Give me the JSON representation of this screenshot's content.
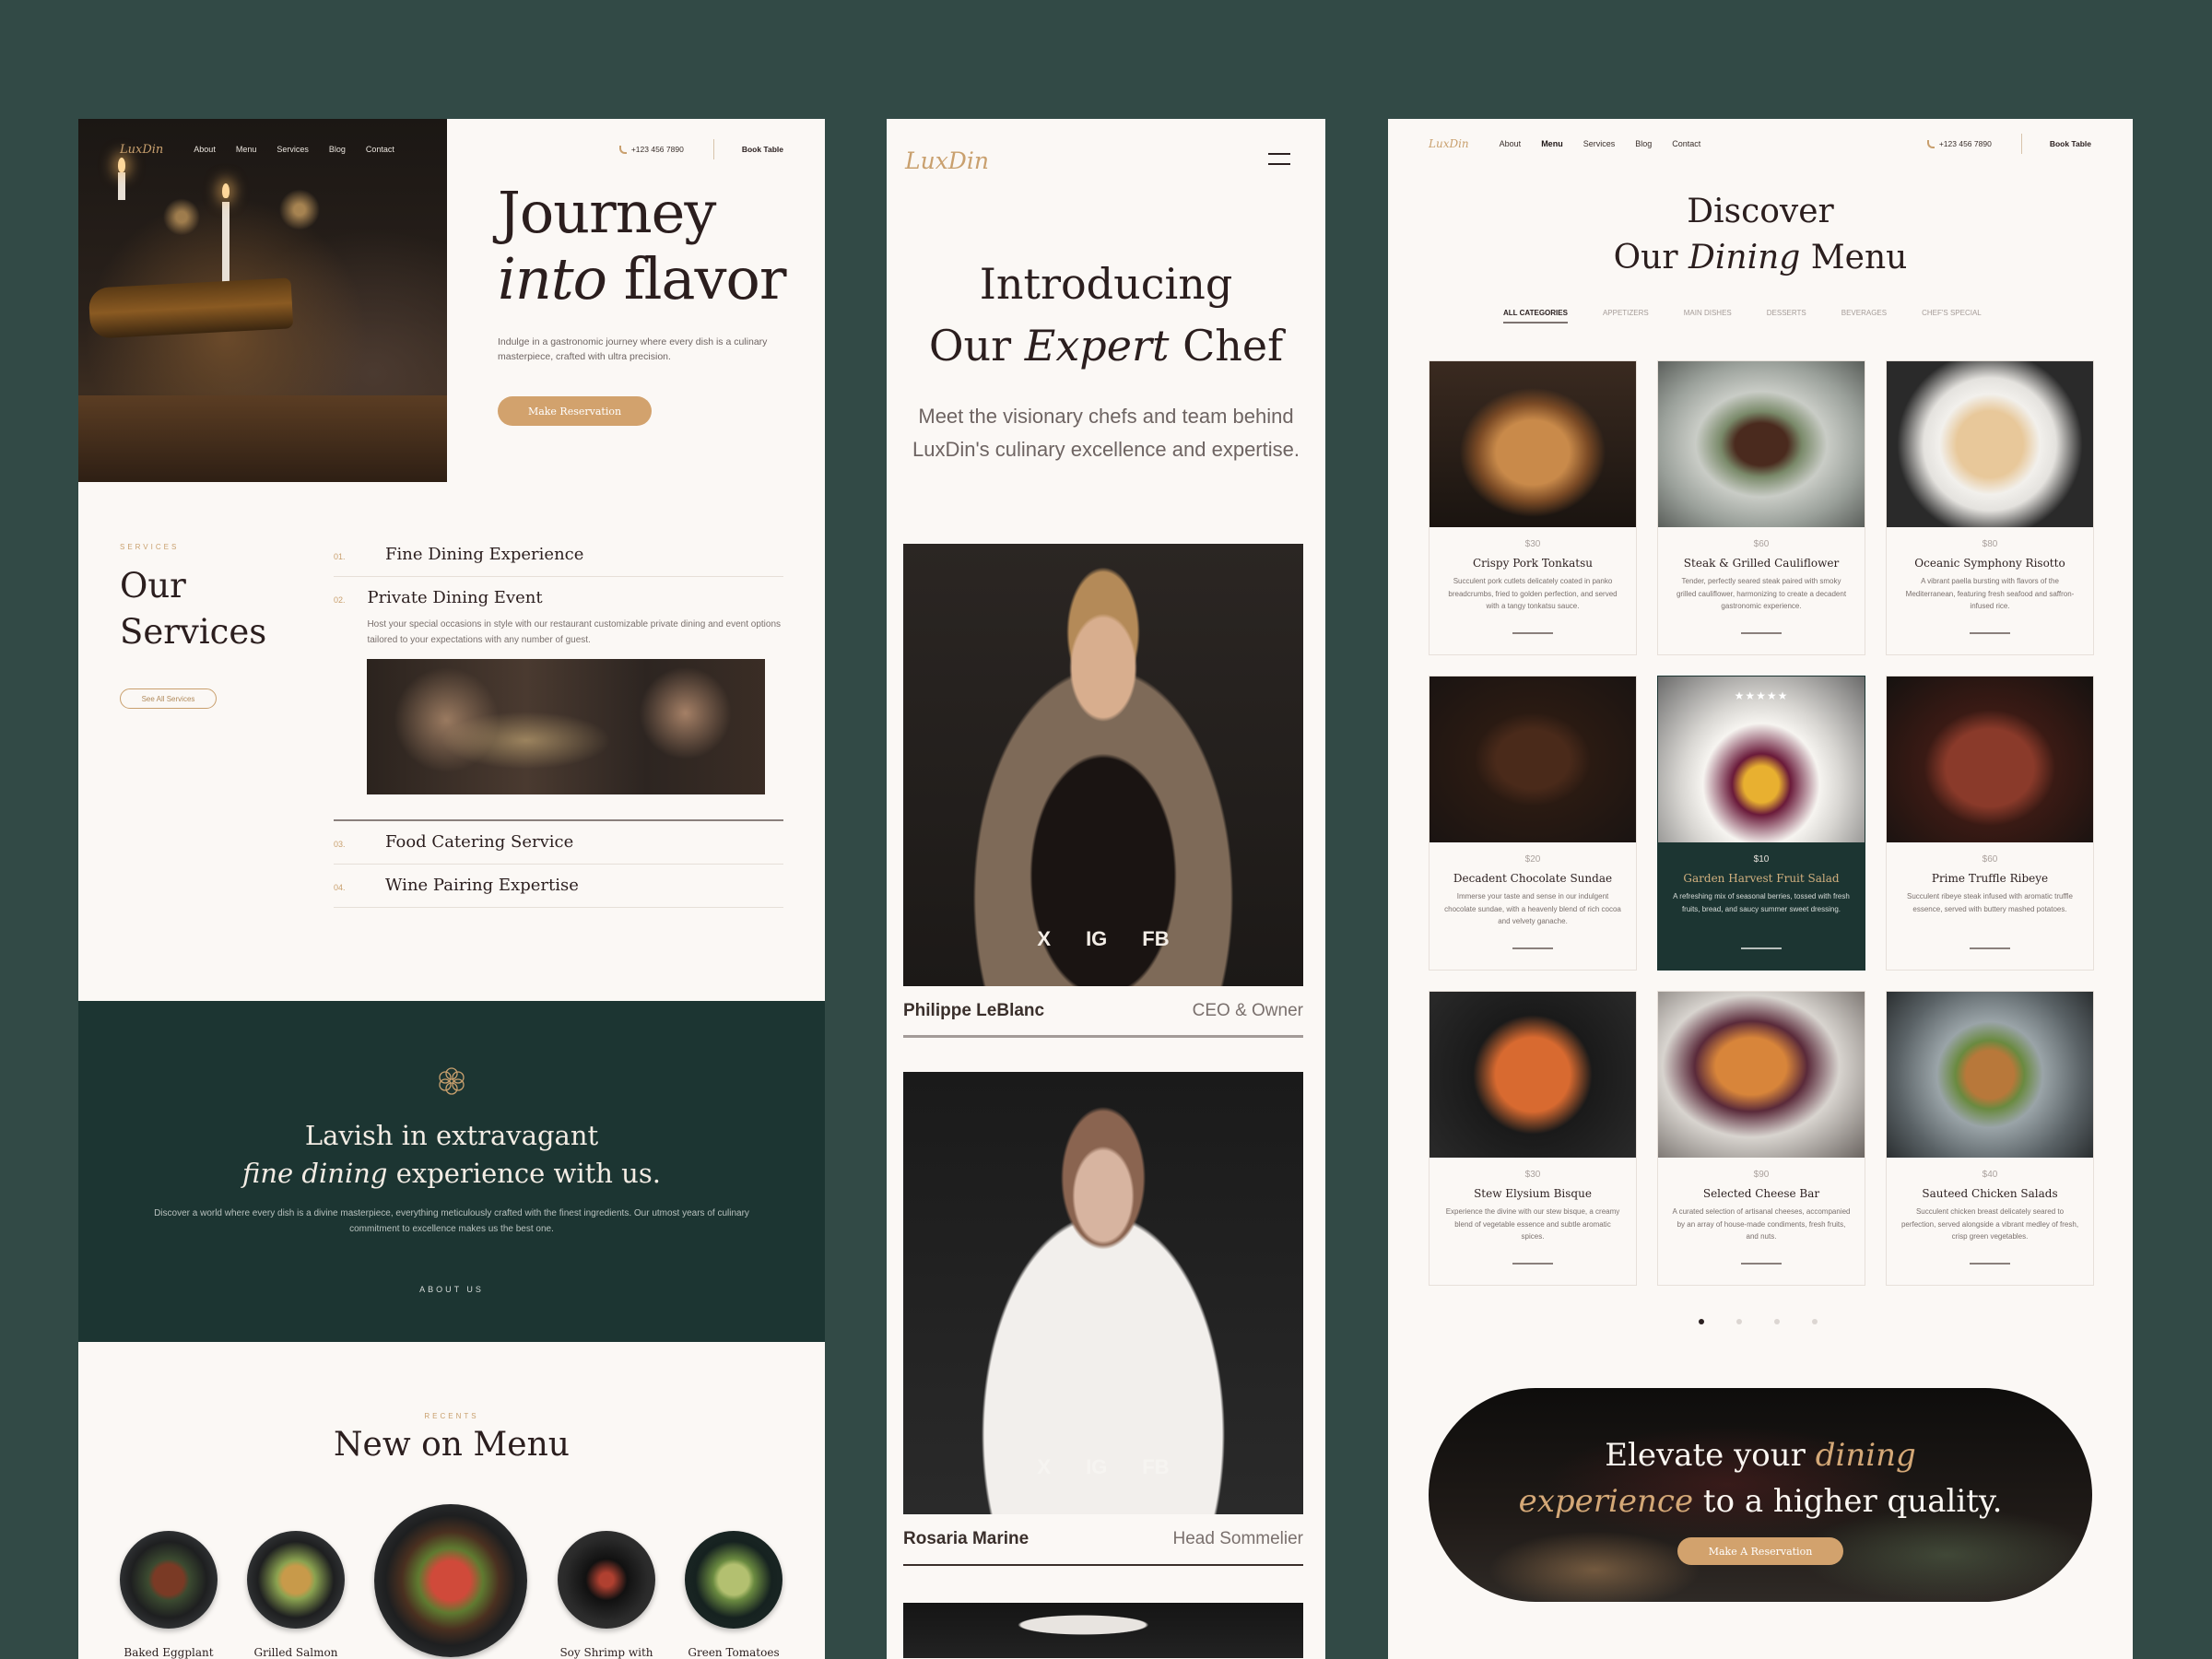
{
  "brand": {
    "name": "LuxDin",
    "accent": "#c9a06e",
    "dark_green": "#1c3532",
    "background": "#324a46"
  },
  "nav": {
    "links": [
      "About",
      "Menu",
      "Services",
      "Blog",
      "Contact"
    ],
    "phone": "+123 456 7890",
    "book_label": "Book Table"
  },
  "home": {
    "hero": {
      "title_line1": "Journey",
      "title_italic": "into",
      "title_rest": "flavor",
      "subtitle": "Indulge in a gastronomic journey where every dish is a culinary masterpiece, crafted with ultra precision.",
      "button": "Make Reservation"
    },
    "services": {
      "eyebrow": "SERVICES",
      "title_line1": "Our",
      "title_line2": "Services",
      "see_all": "See All Services",
      "items": [
        {
          "num": "01.",
          "name": "Fine Dining Experience"
        },
        {
          "num": "02.",
          "name": "Private Dining Event",
          "desc": "Host your special occasions in style with our restaurant customizable private dining and event options tailored to your expectations with any number of guest."
        },
        {
          "num": "03.",
          "name": "Food Catering Service"
        },
        {
          "num": "04.",
          "name": "Wine Pairing Expertise"
        }
      ]
    },
    "lavish": {
      "line1": "Lavish in extravagant",
      "italic": "fine dining",
      "line2_rest": "experience with us.",
      "body": "Discover a world where every dish is a divine masterpiece, everything meticulously crafted with the finest ingredients. Our utmost years of culinary commitment to excellence makes us the best one.",
      "link": "ABOUT US"
    },
    "recents": {
      "eyebrow": "RECENTS",
      "title": "New on Menu",
      "dishes": [
        "Baked Eggplant",
        "Grilled Salmon",
        "",
        "Soy Shrimp with",
        "Green Tomatoes"
      ]
    }
  },
  "chefs_page": {
    "title_line1": "Introducing",
    "title_pre": "Our",
    "title_italic": "Expert",
    "title_post": "Chef",
    "intro": "Meet the visionary chefs and team behind LuxDin's culinary excellence and expertise.",
    "socials": [
      "X",
      "IG",
      "FB"
    ],
    "chefs": [
      {
        "name": "Philippe LeBlanc",
        "role": "CEO & Owner"
      },
      {
        "name": "Rosaria Marine",
        "role": "Head Sommelier"
      }
    ]
  },
  "menu_page": {
    "active_nav": "Menu",
    "title_line1": "Discover",
    "title_pre": "Our",
    "title_italic": "Dining",
    "title_post": "Menu",
    "tabs": [
      "ALL CATEGORIES",
      "APPETIZERS",
      "MAIN DISHES",
      "DESSERTS",
      "BEVERAGES",
      "CHEF'S SPECIAL"
    ],
    "active_tab": "ALL CATEGORIES",
    "items": [
      {
        "price": "$30",
        "name": "Crispy Pork Tonkatsu",
        "desc": "Succulent pork cutlets delicately coated in panko breadcrumbs, fried to golden perfection, and served with a tangy tonkatsu sauce."
      },
      {
        "price": "$60",
        "name": "Steak & Grilled Cauliflower",
        "desc": "Tender, perfectly seared steak paired with smoky grilled cauliflower, harmonizing to create a decadent gastronomic experience."
      },
      {
        "price": "$80",
        "name": "Oceanic Symphony Risotto",
        "desc": "A vibrant paella bursting with flavors of the Mediterranean, featuring fresh seafood and saffron-infused rice."
      },
      {
        "price": "$20",
        "name": "Decadent Chocolate Sundae",
        "desc": "Immerse your taste and sense in our indulgent chocolate sundae, with a heavenly blend of rich cocoa and velvety ganache."
      },
      {
        "price": "$10",
        "name": "Garden Harvest Fruit Salad",
        "desc": "A refreshing mix of seasonal berries, tossed with fresh fruits, bread, and saucy summer sweet dressing.",
        "featured": true,
        "rating": 5
      },
      {
        "price": "$60",
        "name": "Prime Truffle Ribeye",
        "desc": "Succulent ribeye steak infused with aromatic truffle essence, served with buttery mashed potatoes."
      },
      {
        "price": "$30",
        "name": "Stew Elysium Bisque",
        "desc": "Experience the divine with our stew bisque, a creamy blend of vegetable essence and subtle aromatic spices."
      },
      {
        "price": "$90",
        "name": "Selected Cheese Bar",
        "desc": "A curated selection of artisanal cheeses, accompanied by an array of house-made condiments, fresh fruits, and nuts."
      },
      {
        "price": "$40",
        "name": "Sauteed Chicken Salads",
        "desc": "Succulent chicken breast delicately seared to perfection, served alongside a vibrant medley of fresh, crisp green vegetables."
      }
    ],
    "pagination": {
      "pages": 4,
      "current": 1
    },
    "cta": {
      "pre": "Elevate your",
      "italic1": "dining",
      "italic2": "experience",
      "post": "to a higher quality.",
      "button": "Make A Reservation"
    }
  }
}
